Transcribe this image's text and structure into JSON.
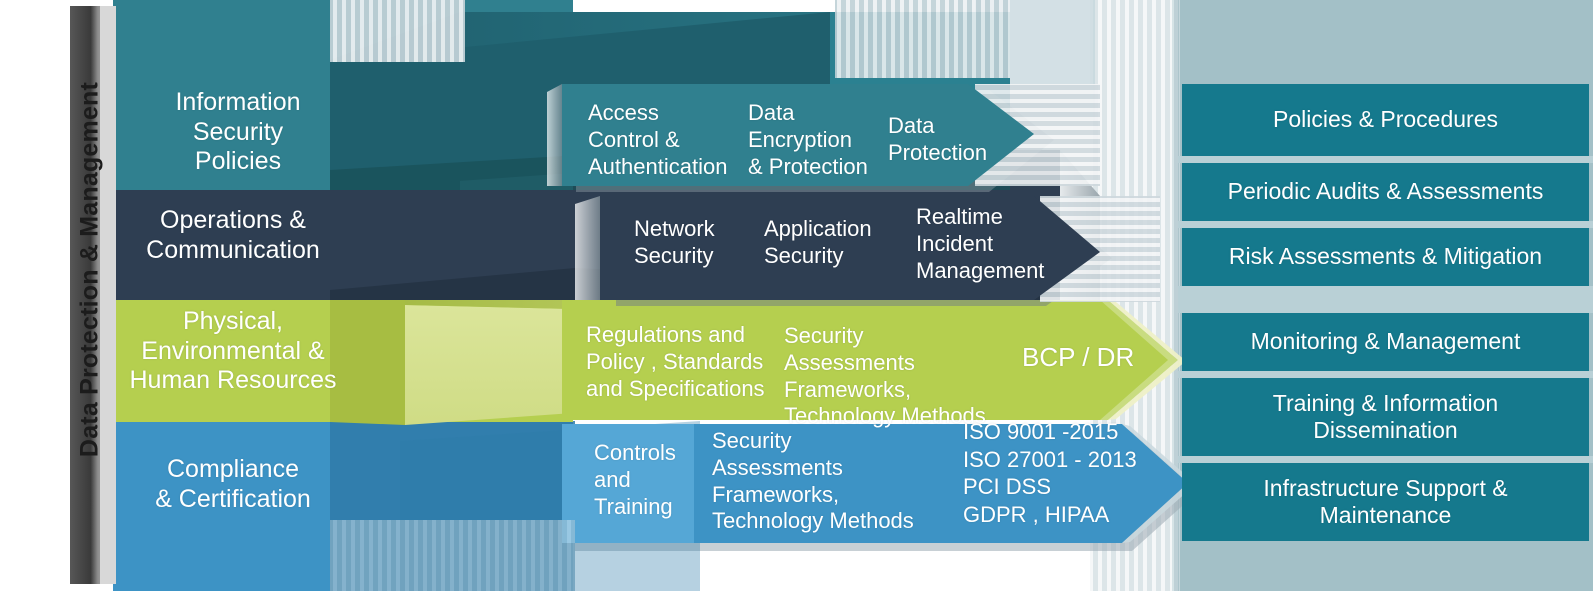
{
  "diagram": {
    "vertical_axis_label": "Data Protection & Management",
    "colors": {
      "teal": "#30808f",
      "teal_dark": "#1f5f6d",
      "navy": "#2e3e52",
      "navy_dark": "#263446",
      "green": "#b5cf4f",
      "green_light": "#d5e08a",
      "green_dark": "#9fb83f",
      "blue": "#3d93c5",
      "blue_dark": "#2f7aa8",
      "panel_bg": "#a3c0c7",
      "panel_item": "#15798d",
      "panel_gap": "#b9d0d6",
      "axis_bar": "#4d4d4d",
      "shadow_gray": "#b0b8bd"
    },
    "categories": [
      {
        "id": "information-security-policies",
        "lines": [
          "Information",
          "Security",
          "Policies"
        ],
        "color": "#30808f"
      },
      {
        "id": "operations-communication",
        "lines": [
          "Operations  &",
          "Communication"
        ],
        "color": "#2e3e52"
      },
      {
        "id": "physical-environmental-hr",
        "lines": [
          "Physical,",
          "Environmental &",
          "Human Resources"
        ],
        "color": "#b5cf4f"
      },
      {
        "id": "compliance-certification",
        "lines": [
          "Compliance",
          "& Certification"
        ],
        "color": "#3d93c5"
      }
    ],
    "rows": [
      {
        "id": "row-information-security-policies",
        "color": "#30808f",
        "steps": [
          {
            "id": "access-control-authentication",
            "lines": [
              "Access",
              "Control &",
              "Authentication"
            ]
          },
          {
            "id": "data-encryption-protection",
            "lines": [
              "Data",
              "Encryption",
              "& Protection"
            ]
          },
          {
            "id": "data-protection",
            "lines": [
              "Data",
              "Protection"
            ]
          }
        ]
      },
      {
        "id": "row-operations-communication",
        "color": "#2e3e52",
        "steps": [
          {
            "id": "network-security",
            "lines": [
              "Network",
              "Security"
            ]
          },
          {
            "id": "application-security",
            "lines": [
              "Application",
              "Security"
            ]
          },
          {
            "id": "realtime-incident-management",
            "lines": [
              "Realtime",
              "Incident",
              "Management"
            ]
          }
        ]
      },
      {
        "id": "row-physical-environmental-hr",
        "color": "#b5cf4f",
        "steps": [
          {
            "id": "regulations-policy-standards",
            "lines": [
              "Regulations and",
              "Policy , Standards",
              "and Specifications"
            ]
          },
          {
            "id": "security-assessments-frameworks",
            "lines": [
              "Security Assessments",
              "Frameworks,",
              "Technology Methods"
            ]
          },
          {
            "id": "bcp-dr",
            "lines": [
              "BCP / DR"
            ]
          }
        ]
      },
      {
        "id": "row-compliance-certification",
        "color": "#3d93c5",
        "steps": [
          {
            "id": "controls-and-training",
            "lines": [
              "Controls",
              "and",
              "Training"
            ]
          },
          {
            "id": "security-assessments-frameworks-2",
            "lines": [
              "Security Assessments",
              "Frameworks,",
              "Technology Methods"
            ]
          },
          {
            "id": "standards-list",
            "lines": [
              "ISO 9001 -2015",
              "ISO 27001 - 2013",
              "PCI DSS",
              "GDPR , HIPAA"
            ]
          }
        ]
      }
    ],
    "outcomes": [
      {
        "id": "policies-procedures",
        "lines": [
          "Policies & Procedures"
        ]
      },
      {
        "id": "periodic-audits-assessments",
        "lines": [
          "Periodic Audits & Assessments"
        ]
      },
      {
        "id": "risk-assessments-mitigation",
        "lines": [
          "Risk Assessments & Mitigation"
        ]
      },
      {
        "id": "monitoring-management",
        "lines": [
          "Monitoring & Management"
        ]
      },
      {
        "id": "training-information-dissemination",
        "lines": [
          "Training & Information",
          "Dissemination"
        ]
      },
      {
        "id": "infrastructure-support-maintenance",
        "lines": [
          "Infrastructure Support &",
          "Maintenance"
        ]
      }
    ]
  }
}
